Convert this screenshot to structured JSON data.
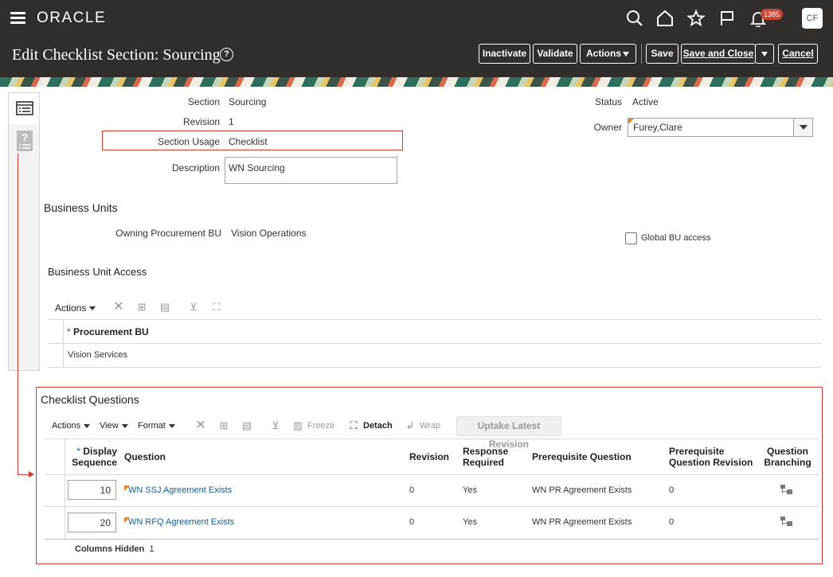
{
  "header": {
    "logo": "ORACLE",
    "notifications_count": "1385",
    "avatar_initials": "CF"
  },
  "titlebar": {
    "title": "Edit Checklist Section: Sourcing",
    "buttons": {
      "inactivate": "Inactivate",
      "validate": "Validate",
      "actions": "Actions",
      "save": "Save",
      "save_and_close": "Save and Close",
      "cancel": "Cancel"
    }
  },
  "form": {
    "section_label": "Section",
    "section_value": "Sourcing",
    "revision_label": "Revision",
    "revision_value": "1",
    "usage_label": "Section Usage",
    "usage_value": "Checklist",
    "description_label": "Description",
    "description_value": "WN Sourcing",
    "status_label": "Status",
    "status_value": "Active",
    "owner_label": "Owner",
    "owner_value": "Furey,Clare"
  },
  "business_units": {
    "heading": "Business Units",
    "owning_label": "Owning Procurement BU",
    "owning_value": "Vision Operations",
    "global_access_label": "Global BU access",
    "global_access_checked": false,
    "access_heading": "Business Unit Access",
    "toolbar": {
      "actions": "Actions"
    },
    "columns": {
      "procurement_bu": "Procurement BU"
    },
    "rows": [
      {
        "procurement_bu": "Vision Services"
      }
    ]
  },
  "checklist_questions": {
    "heading": "Checklist Questions",
    "toolbar": {
      "actions": "Actions",
      "view": "View",
      "format": "Format",
      "freeze": "Freeze",
      "detach": "Detach",
      "wrap": "Wrap",
      "uptake": "Uptake Latest Revision"
    },
    "columns": {
      "display_sequence_1": "Display",
      "display_sequence_2": "Sequence",
      "question": "Question",
      "revision": "Revision",
      "response_required_1": "Response",
      "response_required_2": "Required",
      "prerequisite_question": "Prerequisite Question",
      "prereq_rev_1": "Prerequisite",
      "prereq_rev_2": "Question Revision",
      "branching_1": "Question",
      "branching_2": "Branching"
    },
    "rows": [
      {
        "sequence": "10",
        "question": "WN SSJ Agreement Exists",
        "revision": "0",
        "response_required": "Yes",
        "prerequisite_question": "WN PR Agreement Exists",
        "prerequisite_revision": "0"
      },
      {
        "sequence": "20",
        "question": "WN RFQ Agreement Exists",
        "revision": "0",
        "response_required": "Yes",
        "prerequisite_question": "WN PR Agreement Exists",
        "prerequisite_revision": "0"
      }
    ],
    "columns_hidden_label": "Columns Hidden",
    "columns_hidden_count": "1"
  }
}
